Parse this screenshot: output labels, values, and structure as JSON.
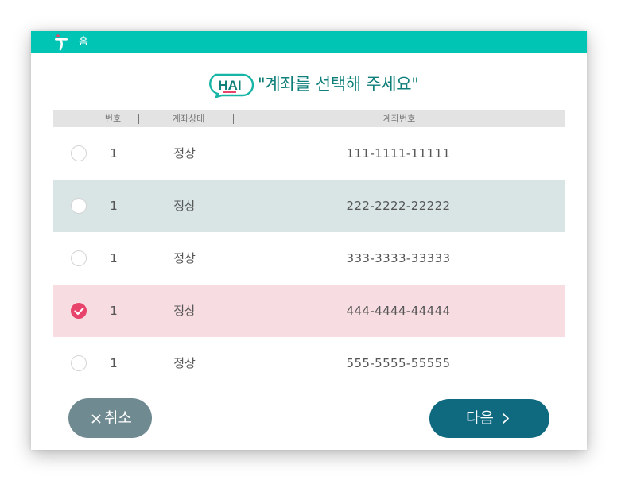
{
  "header": {
    "home_label": "홈"
  },
  "logo": {
    "text": "HAI"
  },
  "prompt": "\"계좌를 선택해 주세요\"",
  "table": {
    "columns": [
      "번호",
      "계좌상태",
      "계좌번호"
    ],
    "rows": [
      {
        "no": "1",
        "status": "정상",
        "account": "111-1111-11111",
        "selected": false
      },
      {
        "no": "1",
        "status": "정상",
        "account": "222-2222-22222",
        "selected": false
      },
      {
        "no": "1",
        "status": "정상",
        "account": "333-3333-33333",
        "selected": false
      },
      {
        "no": "1",
        "status": "정상",
        "account": "444-4444-44444",
        "selected": true
      },
      {
        "no": "1",
        "status": "정상",
        "account": "555-5555-55555",
        "selected": false
      }
    ]
  },
  "buttons": {
    "cancel": "취소",
    "next": "다음",
    "cancel_icon": "close-icon",
    "next_icon": "chevron-right-icon"
  },
  "colors": {
    "topbar": "#00c4b4",
    "cancel_button": "#6f8a91",
    "next_button": "#0f6a80",
    "selected_row": "#f7dce1",
    "alt_row": "#d9e5e5",
    "check_accent": "#e8436b"
  }
}
